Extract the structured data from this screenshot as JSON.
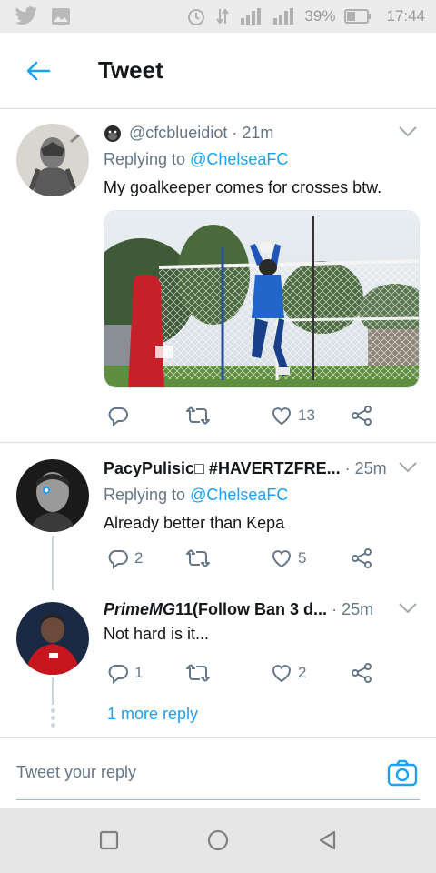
{
  "status_bar": {
    "battery": "39%",
    "time": "17:44",
    "icons": [
      "twitter-icon",
      "image-icon",
      "alarm-icon",
      "data-icon",
      "signal-icon",
      "signal-icon",
      "battery-icon"
    ]
  },
  "header": {
    "title": "Tweet",
    "back_icon": "arrow-left-icon"
  },
  "tweets": [
    {
      "emoji_icon": "gorilla-icon",
      "handle": "@cfcblueidiot",
      "time": "21m",
      "replying_prefix": "Replying to",
      "replying_to": "@ChelseaFC",
      "text": "My goalkeeper comes for crosses btw.",
      "has_media": true,
      "replies": "",
      "retweets": "",
      "likes": "13"
    },
    {
      "name": "PacyPulisic□ #HAVERTZFRE...",
      "time": "25m",
      "replying_prefix": "Replying to",
      "replying_to": "@ChelseaFC",
      "text": "Already better than Kepa",
      "replies": "2",
      "retweets": "",
      "likes": "5"
    },
    {
      "name_italic": "PrimeMG",
      "name_rest": "11(Follow Ban 3 d...",
      "time": "25m",
      "text": "Not hard is it...",
      "replies": "1",
      "retweets": "",
      "likes": "2"
    }
  ],
  "more_reply": "1 more reply",
  "reply_bar": {
    "placeholder": "Tweet your reply"
  },
  "colors": {
    "accent": "#1da1f2",
    "muted": "#657786",
    "text": "#14171a"
  }
}
